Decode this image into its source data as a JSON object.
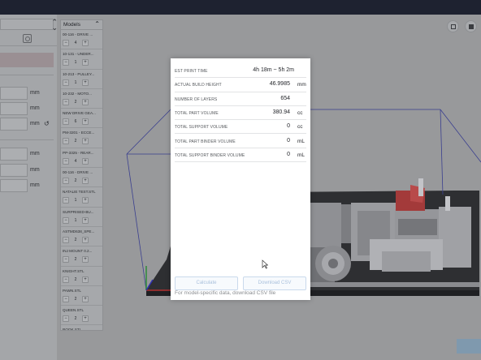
{
  "settings_panel": {
    "units": [
      "mm",
      "mm",
      "mm",
      "mm",
      "mm",
      "mm"
    ]
  },
  "models": {
    "title": "Models",
    "items": [
      {
        "name": "00-116 - DRIVE ...",
        "qty": "4"
      },
      {
        "name": "10-131 - UNDER...",
        "qty": "1"
      },
      {
        "name": "10-213 - PULLEY...",
        "qty": "1"
      },
      {
        "name": "10-232 - MOTO...",
        "qty": "2"
      },
      {
        "name": "NEW DRIVE GEA...",
        "qty": "6"
      },
      {
        "name": "PM-3201 - ECCE...",
        "qty": "2"
      },
      {
        "name": "PP-3325 - REAR...",
        "qty": "4"
      },
      {
        "name": "00-116 - DRIVE ...",
        "qty": "2"
      },
      {
        "name": "NATALIE TEST.STL",
        "qty": "1"
      },
      {
        "name": "SURPRISED-BU...",
        "qty": "1"
      },
      {
        "name": "ASTMD638_SPE...",
        "qty": "2"
      },
      {
        "name": "INJ MOUNT 0.2...",
        "qty": "2"
      },
      {
        "name": "KNIGHT.STL",
        "qty": "2"
      },
      {
        "name": "PAWN.STL",
        "qty": "2"
      },
      {
        "name": "QUEEN.STL",
        "qty": "2"
      },
      {
        "name": "ROOK.STL",
        "qty": ""
      }
    ]
  },
  "stats": {
    "rows": [
      {
        "label": "EST PRINT TIME",
        "value": "4h 18m ~ 5h 2m",
        "unit": ""
      },
      {
        "label": "ACTUAL BUILD HEIGHT",
        "value": "46.9985",
        "unit": "mm"
      },
      {
        "label": "NUMBER OF LAYERS",
        "value": "654",
        "unit": ""
      },
      {
        "label": "TOTAL PART VOLUME",
        "value": "380.94",
        "unit": "cc"
      },
      {
        "label": "TOTAL SUPPORT VOLUME",
        "value": "0",
        "unit": "cc"
      },
      {
        "label": "TOTAL PART BINDER VOLUME",
        "value": "0",
        "unit": "mL"
      },
      {
        "label": "TOTAL SUPPORT BINDER VOLUME",
        "value": "0",
        "unit": "mL"
      }
    ],
    "calculate_label": "Calculate",
    "download_label": "Download CSV",
    "hint": "For model-specific data, download CSV file"
  },
  "icons": {
    "reset": "reset-icon",
    "search": "search-icon",
    "save": "save-icon",
    "cube": "cube-icon"
  },
  "colors": {
    "build_box": "#3a3f8f",
    "accent_red": "#a33a3a"
  }
}
